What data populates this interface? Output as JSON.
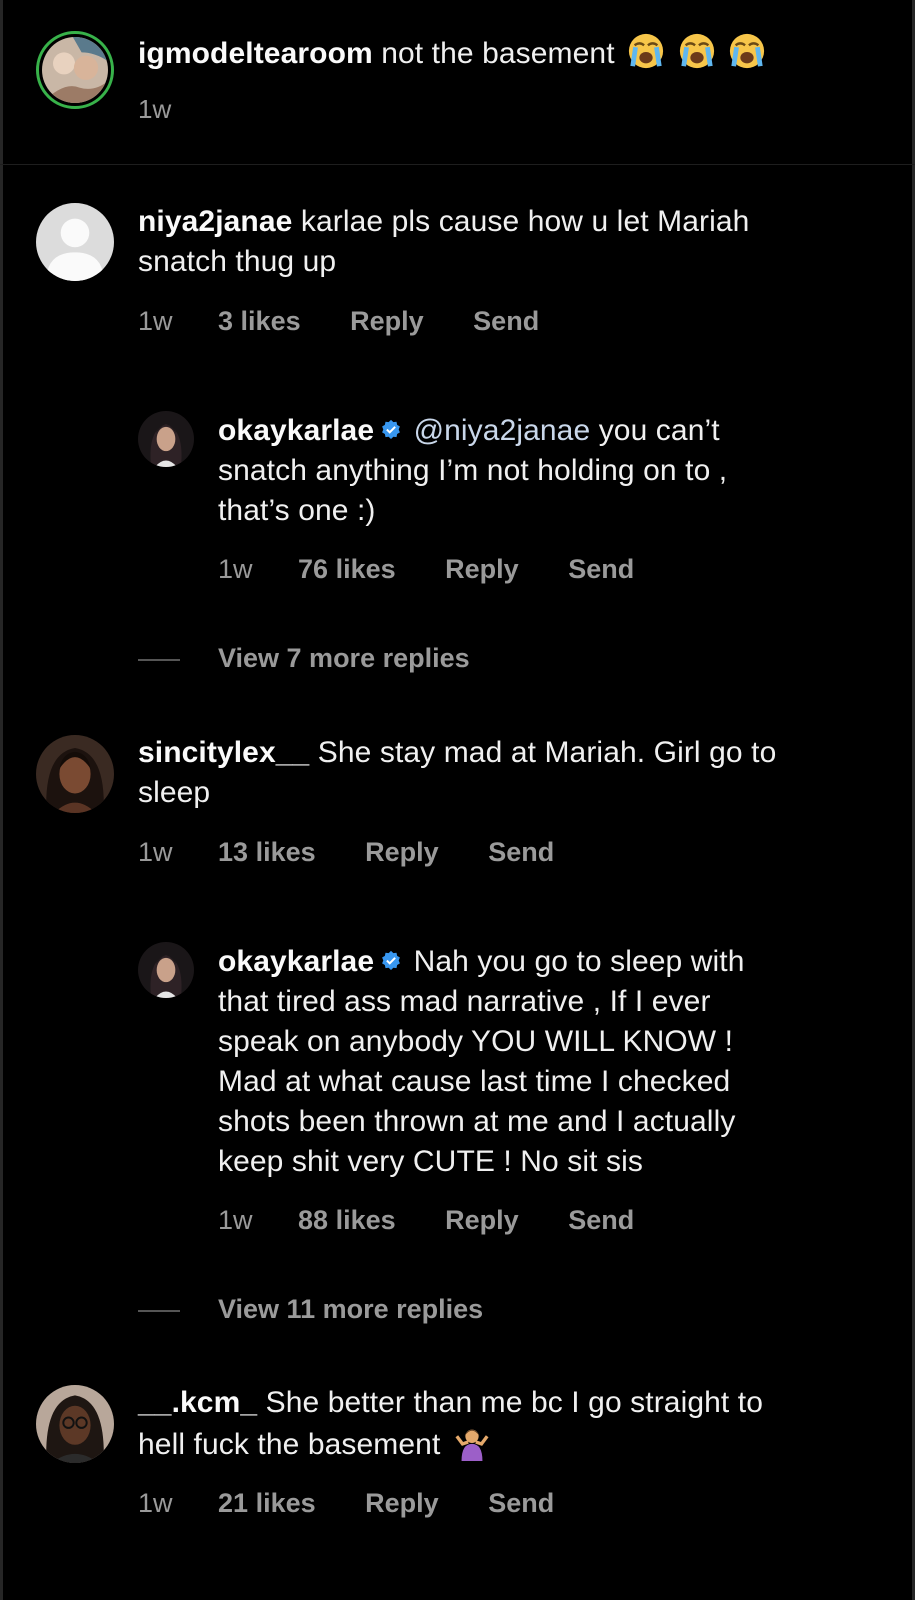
{
  "colors": {
    "background": "#000000",
    "text": "#f0f0f0",
    "meta": "#9a9a9a",
    "verified": "#3897f0",
    "story_ring": "#38b24a"
  },
  "comments": [
    {
      "username": "igmodeltearoom",
      "text": "not the basement",
      "emojis": [
        "loudly-crying-face",
        "loudly-crying-face",
        "loudly-crying-face"
      ],
      "time": "1w"
    },
    {
      "username": "niya2janae",
      "text_line1": "karlae pls cause how u let Mariah",
      "text_line2": "snatch thug up",
      "time": "1w",
      "likes": "3 likes",
      "reply": "Reply",
      "send": "Send",
      "replies": [
        {
          "username": "okaykarlae",
          "verified": true,
          "mention": "@niya2janae",
          "text_line1": "you can’t",
          "text_line2": "snatch anything I’m not holding on to ,",
          "text_line3": "that’s one :)",
          "time": "1w",
          "likes": "76 likes",
          "reply": "Reply",
          "send": "Send"
        }
      ],
      "view_more": "View 7 more replies"
    },
    {
      "username": "sincitylex__",
      "text_line1": "She stay mad at Mariah. Girl go to",
      "text_line2": "sleep",
      "time": "1w",
      "likes": "13 likes",
      "reply": "Reply",
      "send": "Send",
      "replies": [
        {
          "username": "okaykarlae",
          "verified": true,
          "text_line1": "Nah you go to sleep with",
          "text_line2": "that tired ass mad narrative , If I ever",
          "text_line3": "speak on anybody YOU WILL KNOW !",
          "text_line4": "Mad at what cause last time I checked",
          "text_line5": "shots been thrown at me and I actually",
          "text_line6": "keep shit very CUTE ! No sit sis",
          "time": "1w",
          "likes": "88 likes",
          "reply": "Reply",
          "send": "Send"
        }
      ],
      "view_more": "View 11 more replies"
    },
    {
      "username": "__.kcm_",
      "text_line1": "She better than me bc I go straight to",
      "text_line2": "hell fuck the basement",
      "emojis": [
        "person-shrugging"
      ],
      "time": "1w",
      "likes": "21 likes",
      "reply": "Reply",
      "send": "Send"
    }
  ]
}
